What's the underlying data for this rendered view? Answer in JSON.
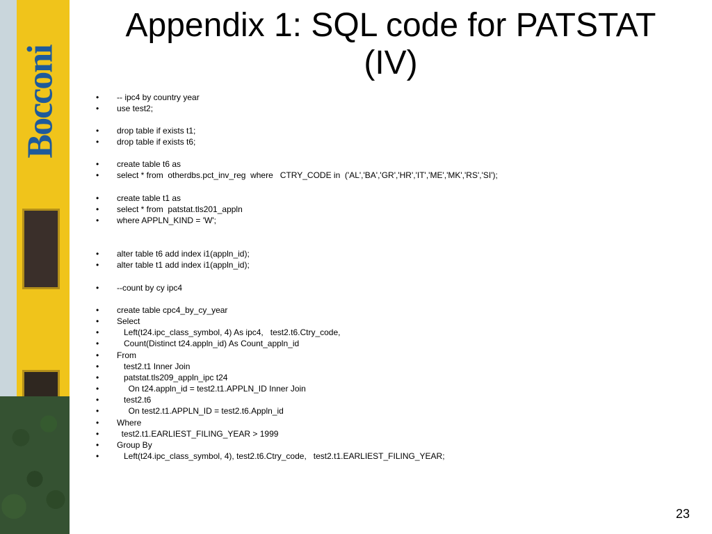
{
  "side": {
    "logo_text": "Bocconi"
  },
  "title": "Appendix 1: SQL code for PATSTAT (IV)",
  "pageNumber": "23",
  "lines": [
    "-- ipc4 by country year",
    "use test2;",
    "",
    "drop table if exists t1;",
    "drop table if exists t6;",
    "",
    "create table t6 as",
    "select * from  otherdbs.pct_inv_reg  where   CTRY_CODE in  ('AL','BA','GR','HR','IT','ME','MK','RS','SI');",
    "",
    "create table t1 as",
    "select * from  patstat.tls201_appln",
    "where APPLN_KIND = 'W';",
    "",
    "",
    "alter table t6 add index i1(appln_id);",
    "alter table t1 add index i1(appln_id);",
    "",
    "--count by cy ipc4",
    "",
    "create table cpc4_by_cy_year",
    "Select",
    "   Left(t24.ipc_class_symbol, 4) As ipc4,   test2.t6.Ctry_code,",
    "   Count(Distinct t24.appln_id) As Count_appln_id",
    "From",
    "   test2.t1 Inner Join",
    "   patstat.tls209_appln_ipc t24",
    "     On t24.appln_id = test2.t1.APPLN_ID Inner Join",
    "   test2.t6",
    "     On test2.t1.APPLN_ID = test2.t6.Appln_id",
    "Where",
    "  test2.t1.EARLIEST_FILING_YEAR > 1999",
    "Group By",
    "   Left(t24.ipc_class_symbol, 4), test2.t6.Ctry_code,   test2.t1.EARLIEST_FILING_YEAR;"
  ]
}
